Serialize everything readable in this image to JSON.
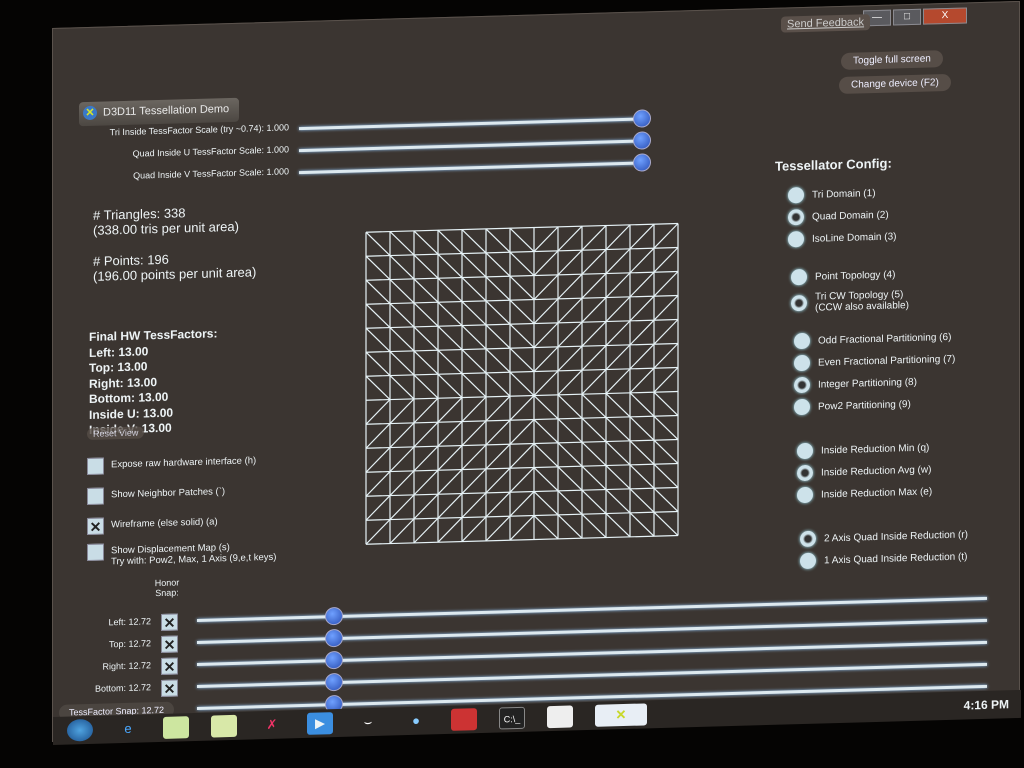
{
  "window": {
    "title": "D3D11 Tessellation Demo",
    "send_feedback": "Send Feedback",
    "minimize": "—",
    "maximize": "□",
    "close": "X"
  },
  "buttons": {
    "toggle_full_screen": "Toggle full screen",
    "change_device": "Change device (F2)",
    "reset_view": "Reset View"
  },
  "top_sliders": [
    {
      "label": "Tri Inside TessFactor Scale (try ~0.74): 1.000",
      "value": 1.0
    },
    {
      "label": "Quad Inside U TessFactor Scale: 1.000",
      "value": 1.0
    },
    {
      "label": "Quad Inside V TessFactor Scale: 1.000",
      "value": 1.0
    }
  ],
  "stats": {
    "triangles": "# Triangles: 338",
    "tris_per_area": "(338.00 tris per unit area)",
    "points": "# Points: 196",
    "points_per_area": "(196.00 points per unit area)"
  },
  "final": {
    "title": "Final HW TessFactors:",
    "lines": [
      "Left: 13.00",
      "Top: 13.00",
      "Right: 13.00",
      "Bottom: 13.00",
      "Inside U: 13.00",
      "Inside V: 13.00"
    ]
  },
  "grid": {
    "divisions": 13
  },
  "checkboxes": [
    {
      "label": "Expose raw hardware interface (h)",
      "checked": false
    },
    {
      "label": "Show Neighbor Patches (`)",
      "checked": false
    },
    {
      "label": "Wireframe (else solid) (a)",
      "checked": true
    },
    {
      "label": "Show Displacement Map (s)",
      "label2": "Try with: Pow2, Max, 1 Axis (9,e,t keys)",
      "checked": false
    }
  ],
  "honor_snap": "Honor Snap:",
  "edge_sliders": [
    {
      "label": "Left: 12.72",
      "snap": true
    },
    {
      "label": "Top: 12.72",
      "snap": true
    },
    {
      "label": "Right: 12.72",
      "snap": true
    },
    {
      "label": "Bottom: 12.72",
      "snap": true
    }
  ],
  "snap_slider": {
    "label": "TessFactor Snap: 12.72"
  },
  "config": {
    "title": "Tessellator Config:",
    "groups": [
      [
        {
          "label": "Tri Domain (1)",
          "on": false
        },
        {
          "label": "Quad Domain (2)",
          "on": true
        },
        {
          "label": "IsoLine Domain (3)",
          "on": false
        }
      ],
      [
        {
          "label": "Point Topology (4)",
          "on": false
        },
        {
          "label": "Tri CW Topology (5)",
          "label2": "(CCW also available)",
          "on": true
        }
      ],
      [
        {
          "label": "Odd Fractional Partitioning (6)",
          "on": false
        },
        {
          "label": "Even Fractional Partitioning (7)",
          "on": false
        },
        {
          "label": "Integer Partitioning (8)",
          "on": true
        },
        {
          "label": "Pow2 Partitioning (9)",
          "on": false
        }
      ],
      [
        {
          "label": "Inside Reduction Min (q)",
          "on": false
        },
        {
          "label": "Inside Reduction Avg (w)",
          "on": true
        },
        {
          "label": "Inside Reduction Max (e)",
          "on": false
        }
      ],
      [
        {
          "label": "2 Axis Quad Inside Reduction (r)",
          "on": true
        },
        {
          "label": "1 Axis Quad Inside Reduction (t)",
          "on": false
        }
      ]
    ]
  },
  "taskbar": {
    "clock": "4:16 PM"
  }
}
